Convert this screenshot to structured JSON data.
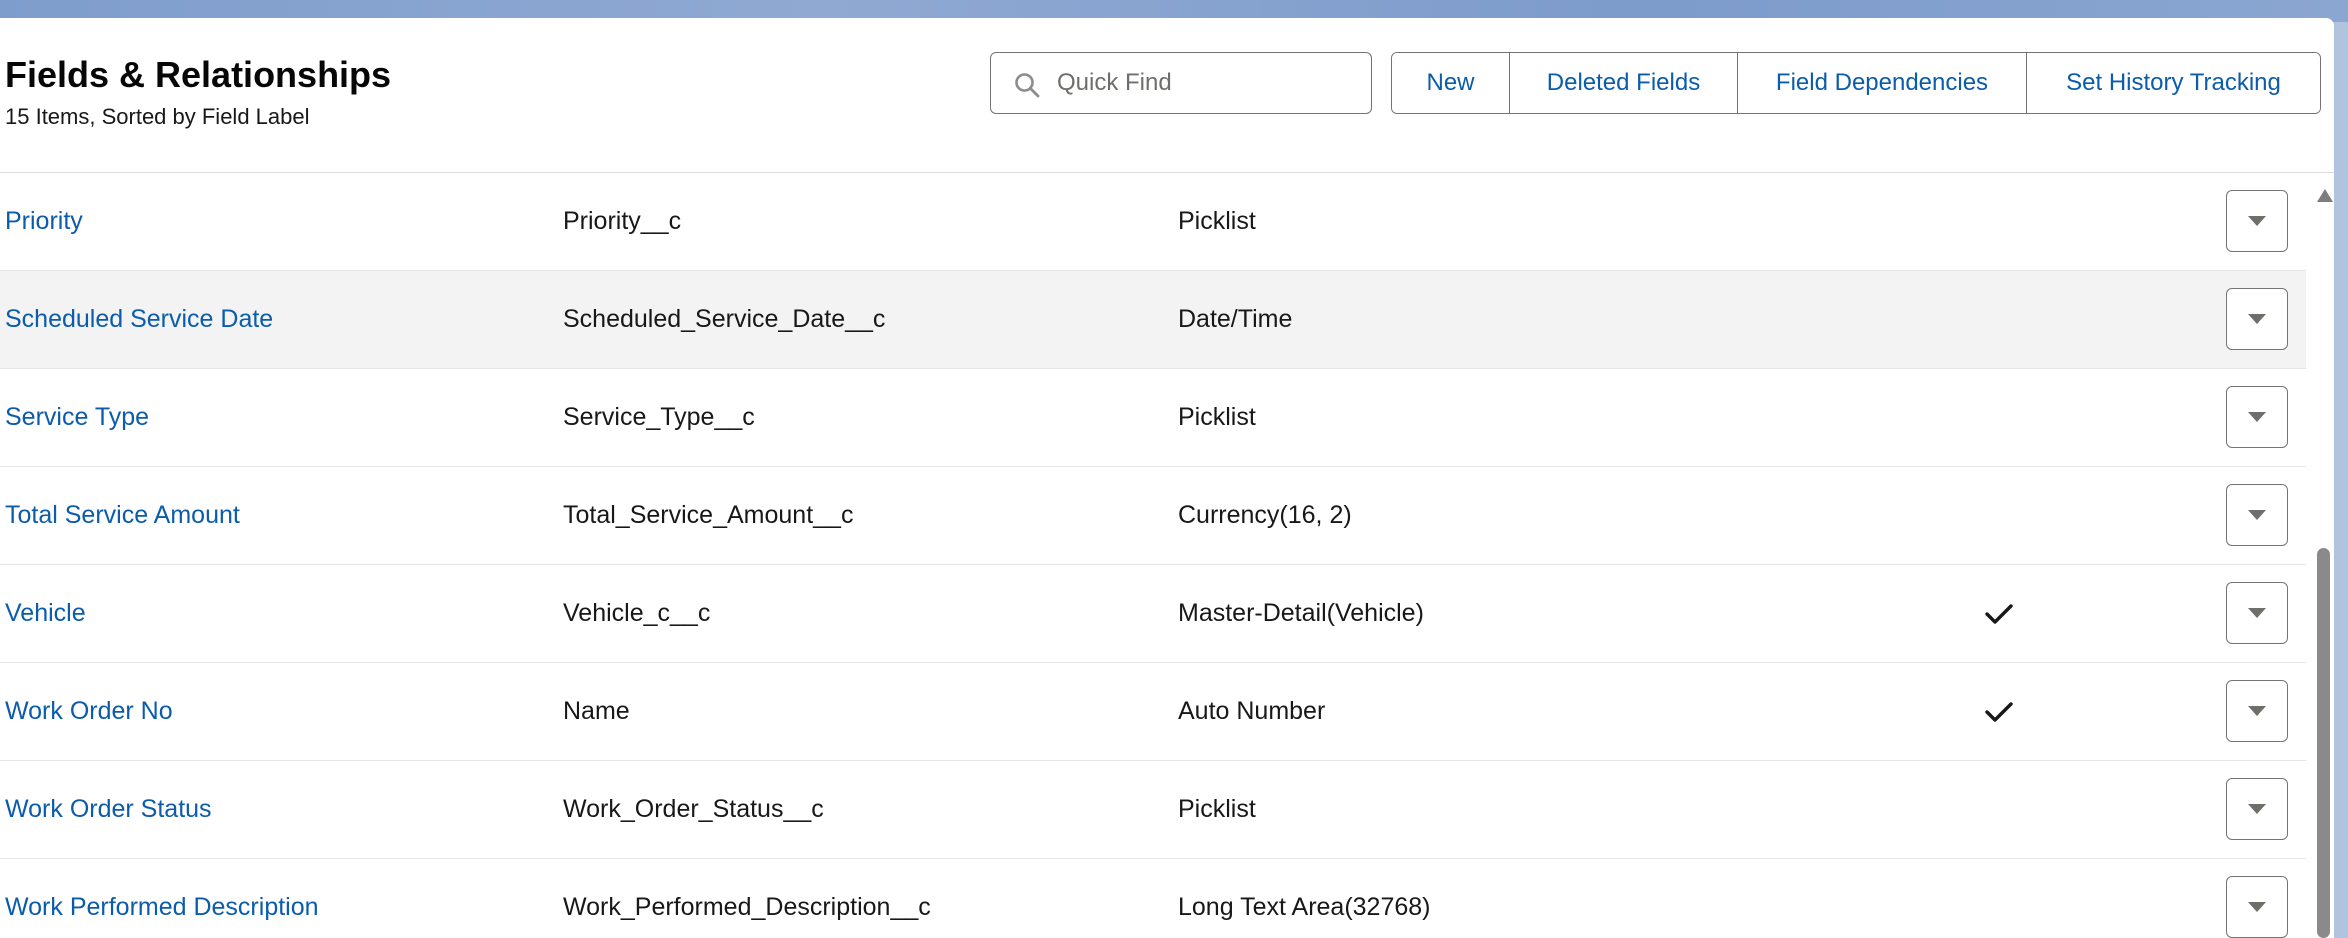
{
  "header": {
    "title": "Fields & Relationships",
    "subtitle": "15 Items, Sorted by Field Label"
  },
  "search": {
    "placeholder": "Quick Find",
    "value": "",
    "icon": "search-icon"
  },
  "buttons": {
    "new": "New",
    "deleted_fields": "Deleted Fields",
    "field_dependencies": "Field Dependencies",
    "set_history_tracking": "Set History Tracking"
  },
  "rows": [
    {
      "label": "Priority",
      "api_name": "Priority__c",
      "type": "Picklist",
      "indexed": ""
    },
    {
      "label": "Scheduled Service Date",
      "api_name": "Scheduled_Service_Date__c",
      "type": "Date/Time",
      "indexed": ""
    },
    {
      "label": "Service Type",
      "api_name": "Service_Type__c",
      "type": "Picklist",
      "indexed": ""
    },
    {
      "label": "Total Service Amount",
      "api_name": "Total_Service_Amount__c",
      "type": "Currency(16, 2)",
      "indexed": ""
    },
    {
      "label": "Vehicle",
      "api_name": "Vehicle_c__c",
      "type": "Master-Detail(Vehicle)",
      "indexed": "check-icon"
    },
    {
      "label": "Work Order No",
      "api_name": "Name",
      "type": "Auto Number",
      "indexed": "check-icon"
    },
    {
      "label": "Work Order Status",
      "api_name": "Work_Order_Status__c",
      "type": "Picklist",
      "indexed": ""
    },
    {
      "label": "Work Performed Description",
      "api_name": "Work_Performed_Description__c",
      "type": "Long Text Area(32768)",
      "indexed": ""
    }
  ],
  "colors": {
    "link": "#0b5cab",
    "text": "#181818",
    "border": "#747474",
    "hover_row": "#f3f3f3",
    "banner": "#8fa9d2"
  }
}
